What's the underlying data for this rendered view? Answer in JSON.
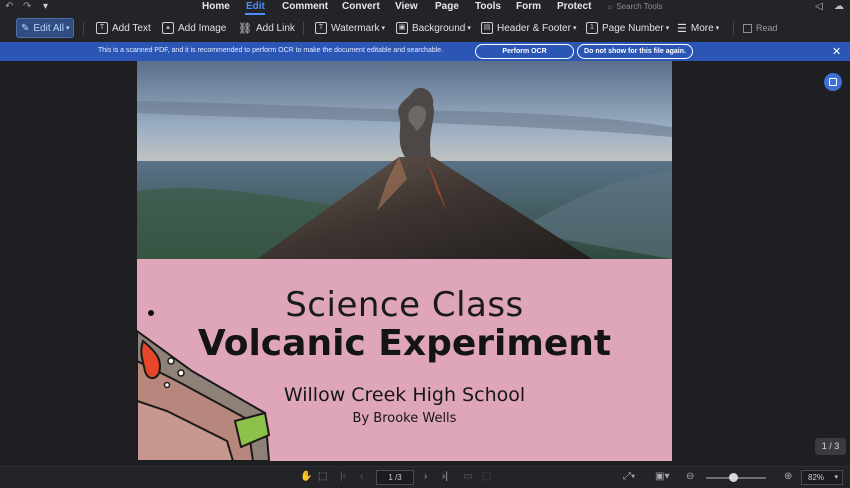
{
  "menu": {
    "items": [
      {
        "label": "Home",
        "active": false
      },
      {
        "label": "Edit",
        "active": true
      },
      {
        "label": "Comment",
        "active": false
      },
      {
        "label": "Convert",
        "active": false
      },
      {
        "label": "View",
        "active": false
      },
      {
        "label": "Page",
        "active": false
      },
      {
        "label": "Tools",
        "active": false
      },
      {
        "label": "Form",
        "active": false
      },
      {
        "label": "Protect",
        "active": false
      }
    ],
    "search_placeholder": "Search Tools"
  },
  "toolbar": {
    "edit_all": "Edit All",
    "add_text": "Add Text",
    "add_image": "Add Image",
    "add_link": "Add Link",
    "watermark": "Watermark",
    "background": "Background",
    "header_footer": "Header & Footer",
    "page_number": "Page Number",
    "more": "More",
    "read": "Read"
  },
  "ocr_banner": {
    "message": "This is a scanned PDF, and it is recommended to perform OCR to make the document editable and searchable.",
    "perform_ocr": "Perform OCR",
    "dont_show": "Do not show for this file again."
  },
  "document": {
    "subtitle": "Science Class",
    "title": "Volcanic Experiment",
    "school": "Willow Creek High School",
    "author": "By Brooke Wells"
  },
  "page_badge": "1 / 3",
  "statusbar": {
    "page_input": "1 /3",
    "zoom": "82%"
  },
  "colors": {
    "accent": "#4d8cff",
    "banner": "#2b56b5",
    "pink_panel": "#dfa6b9"
  }
}
